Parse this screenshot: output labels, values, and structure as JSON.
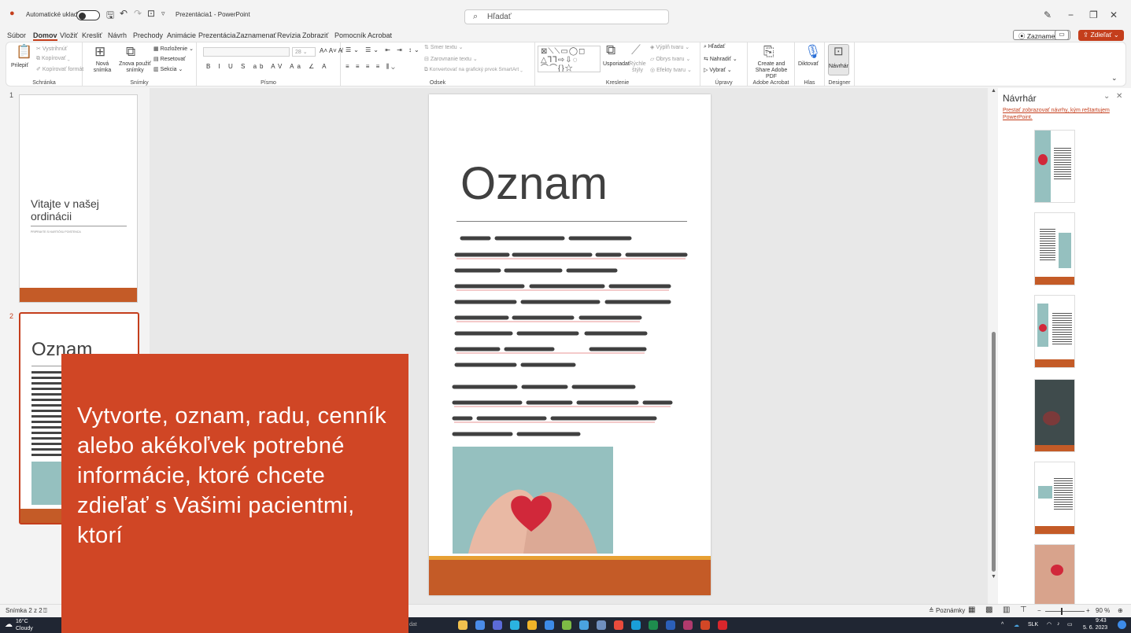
{
  "titlebar": {
    "autosave_label": "Automatické ukladanie",
    "doc_title": "Prezentácia1 - PowerPoint",
    "search_placeholder": "Hľadať"
  },
  "menu": {
    "tabs": [
      "Súbor",
      "Domov",
      "Vložiť",
      "Kresliť",
      "Návrh",
      "Prechody",
      "Animácie",
      "Prezentácia",
      "Zaznamenať",
      "Revízia",
      "Zobraziť",
      "Pomocník",
      "Acrobat"
    ],
    "active": "Domov",
    "record_button": "⦿ Zaznamenať",
    "share_button": "⇪ Zdieľať ⌄"
  },
  "ribbon": {
    "groups": {
      "clipboard": "Schránka",
      "slides": "Snímky",
      "font": "Písmo",
      "paragraph": "Odsek",
      "drawing": "Kreslenie",
      "editing": "Úpravy",
      "acrobat": "Adobe Acrobat",
      "voice": "Hlas",
      "designer": "Designer"
    },
    "paste": "Prilepiť",
    "cut": "Vystrihnúť",
    "copy": "Kopírovať",
    "format_painter": "Kopírovať formát",
    "new_slide": "Nová snímka",
    "reuse_slides": "Znova použiť snímky",
    "layout": "Rozloženie",
    "reset": "Resetovať",
    "section": "Sekcia",
    "font_size": "28",
    "text_direction": "Smer textu",
    "align_text": "Zarovnanie textu",
    "smartart": "Konvertovať na grafický prvok SmartArt",
    "arrange": "Usporiadať",
    "quick_styles": "Rýchle štýly",
    "shape_fill": "Výplň tvaru",
    "shape_outline": "Obrys tvaru",
    "shape_effects": "Efekty tvaru",
    "find": "Hľadať",
    "replace": "Nahradiť",
    "select": "Vybrať",
    "create_share_pdf": "Create and Share Adobe PDF",
    "dictate": "Diktovať",
    "designer_btn": "Návrhár"
  },
  "thumbnails": [
    {
      "num": "1",
      "title": "Vitajte v našej ordinácii",
      "sub": "PRIPRAVTE SI KARTIČKU POISTENCA"
    },
    {
      "num": "2",
      "title": "Oznam"
    }
  ],
  "slide": {
    "title": "Oznam"
  },
  "design_pane": {
    "title": "Návrhár",
    "link": "Prestať zobrazovať návrhy, kým reštartujem PowerPoint."
  },
  "tooltip": {
    "text": "Vytvorte, oznam, radu, cenník alebo akékoľvek potrebné informácie, ktoré chcete zdieľať s Vašimi pacientmi, ktorí"
  },
  "status": {
    "slide_counter": "Snímka 2 z 2",
    "notes": "Poznámky",
    "zoom": "90 %"
  },
  "taskbar": {
    "temp": "16°C",
    "weather": "Cloudy",
    "search": "dat",
    "lang": "SLK",
    "time": "9:43",
    "date": "5. 6. 2023"
  },
  "colors": {
    "accent": "#c43e1c",
    "tooltip": "#d04625",
    "band": "#c45b27",
    "band_top": "#e7a033"
  }
}
